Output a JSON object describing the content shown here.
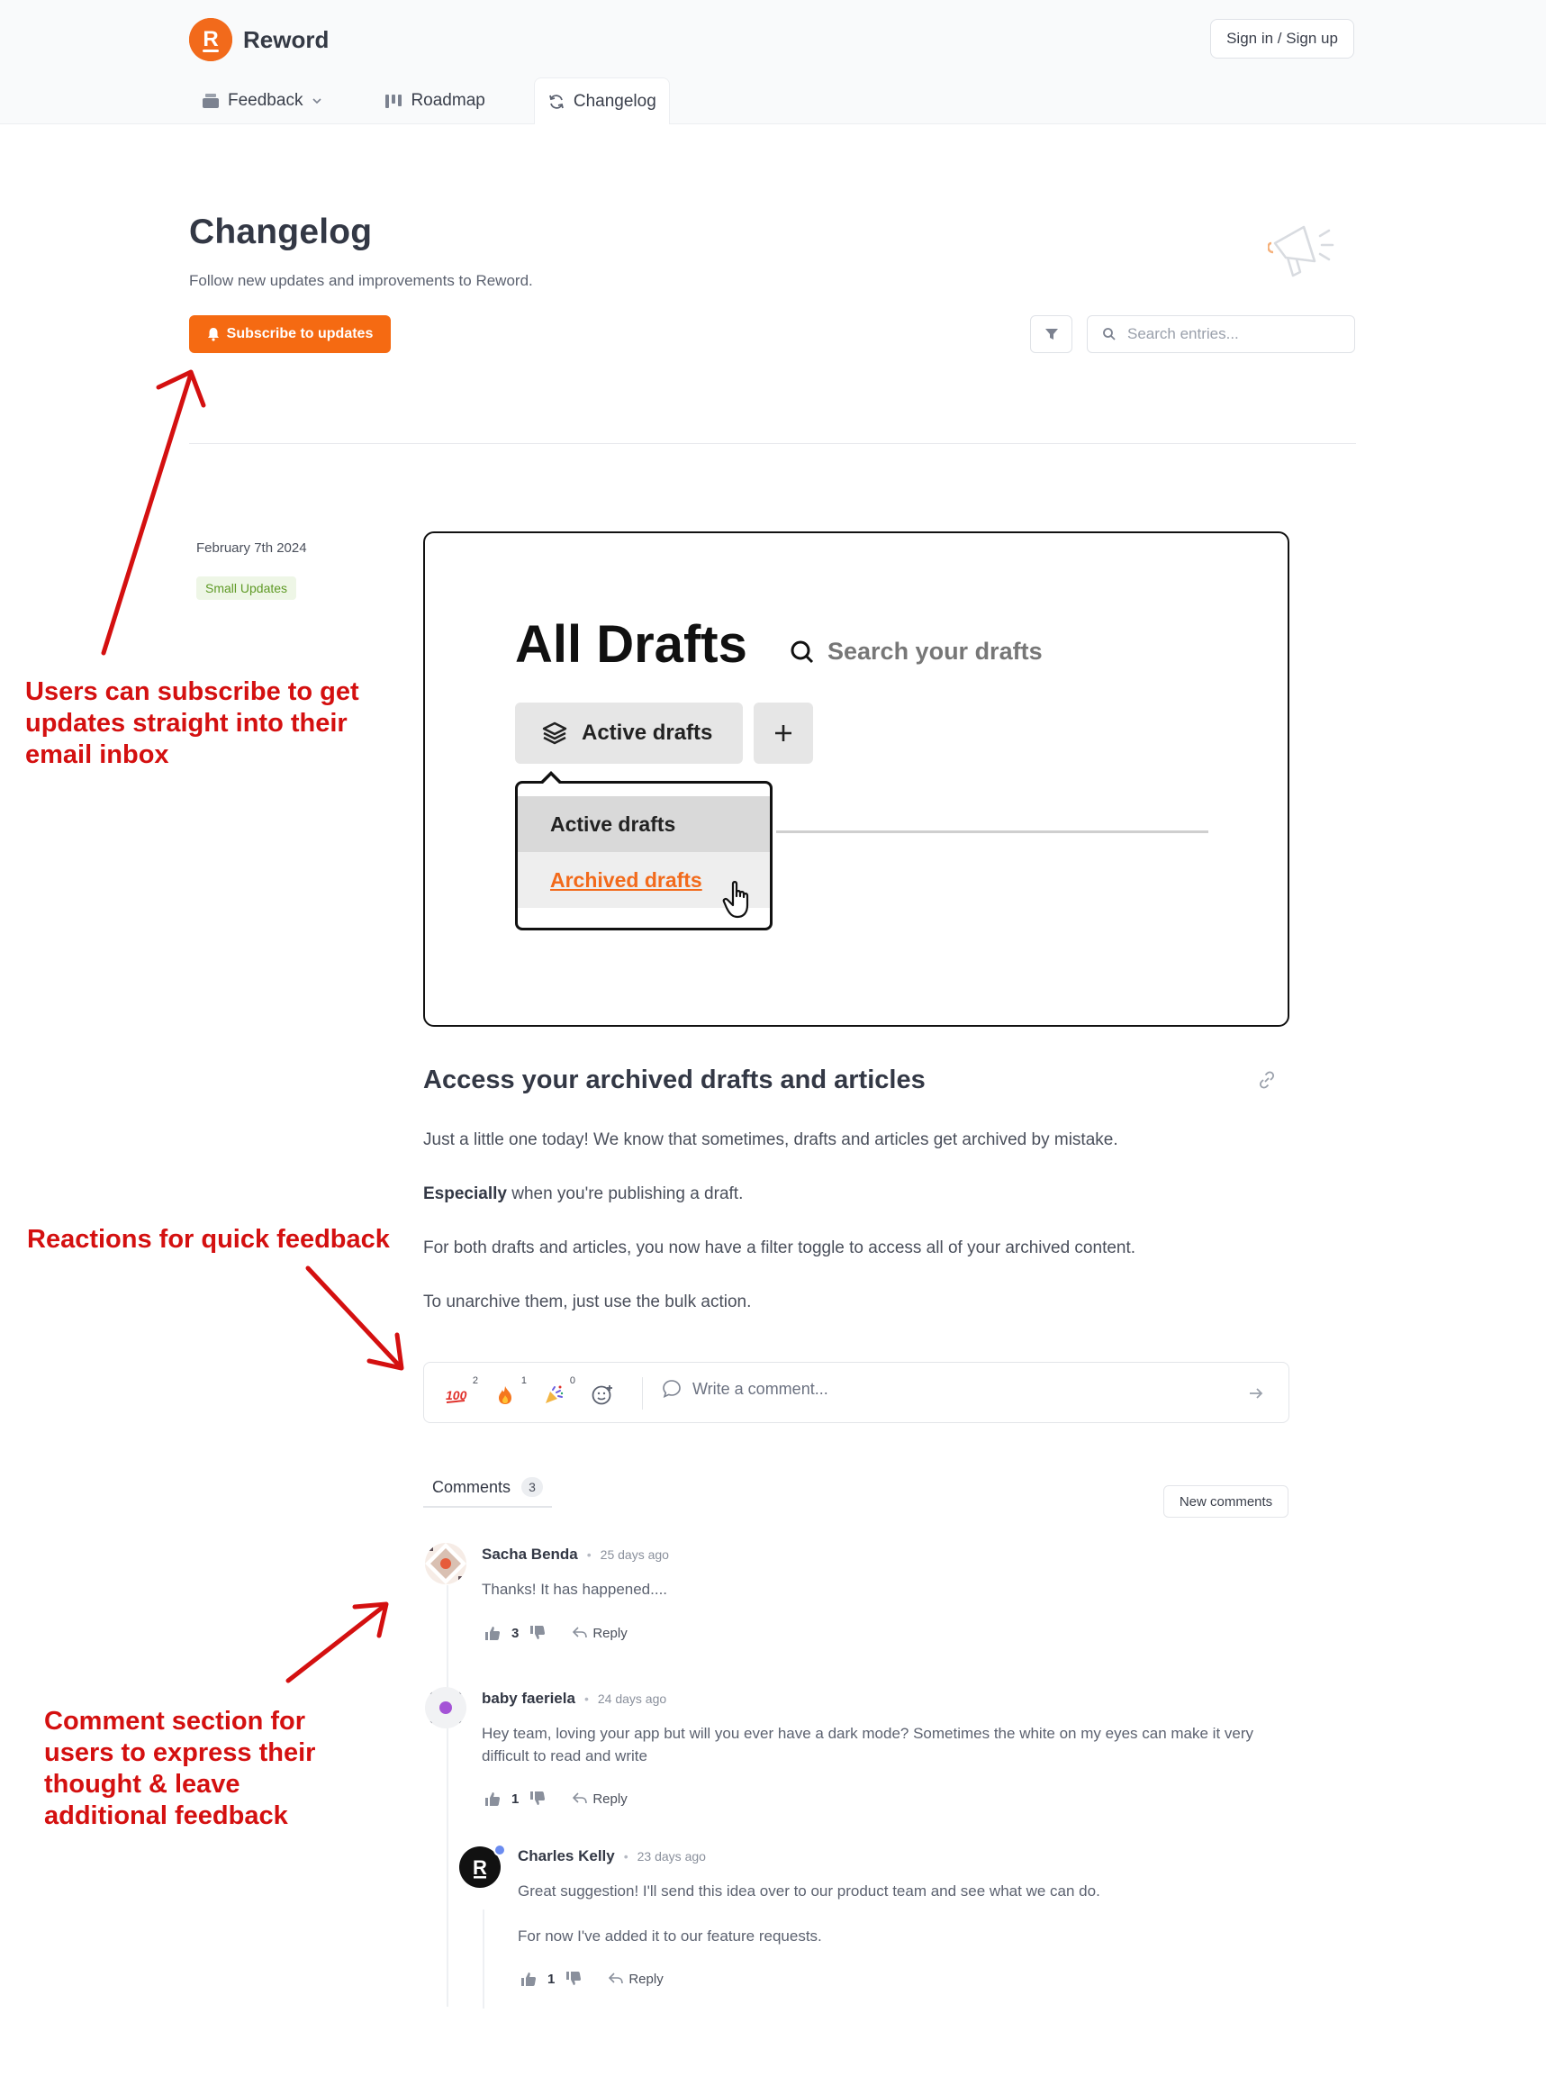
{
  "header": {
    "brand_name": "Reword",
    "brand_letter": "R",
    "signin_label": "Sign in / Sign up",
    "nav": [
      {
        "label": "Feedback",
        "icon": "inbox-icon"
      },
      {
        "label": "Roadmap",
        "icon": "roadmap-icon"
      },
      {
        "label": "Changelog",
        "icon": "refresh-icon",
        "active": true
      }
    ]
  },
  "page": {
    "title": "Changelog",
    "subtitle": "Follow new updates and improvements to Reword.",
    "subscribe_label": "Subscribe to updates",
    "search_placeholder": "Search entries..."
  },
  "entry": {
    "date": "February 7th 2024",
    "tag": "Small Updates",
    "screenshot": {
      "title": "All Drafts",
      "search_text": "Search your drafts",
      "active_button": "Active drafts",
      "menu_item_1": "Active drafts",
      "menu_item_2": "Archived drafts"
    },
    "title": "Access your archived drafts and articles",
    "paragraph_1": "Just a little one today! We know that sometimes, drafts and articles get archived by mistake.",
    "paragraph_2_bold": "Especially",
    "paragraph_2_rest": " when you're publishing a draft.",
    "paragraph_3": "For both drafts and articles, you now have a filter toggle to access all of your archived content.",
    "paragraph_4": "To unarchive them, just use the bulk action."
  },
  "reactions": [
    {
      "icon": "hundred-points-icon",
      "count": "2"
    },
    {
      "icon": "fire-icon",
      "count": "1"
    },
    {
      "icon": "party-popper-icon",
      "count": "0"
    }
  ],
  "comment_placeholder": "Write a comment...",
  "comments_section": {
    "tab_label": "Comments",
    "count": "3",
    "new_comments_label": "New comments",
    "reply_label": "Reply",
    "comments": [
      {
        "author": "Sacha Benda",
        "time": "25 days ago",
        "body": "Thanks! It has happened....",
        "likes": "3"
      },
      {
        "author": "baby faeriela",
        "time": "24 days ago",
        "body": "Hey team, loving your app but will you ever have a dark mode? Sometimes the white on my eyes can make it very difficult to read and write",
        "likes": "1"
      },
      {
        "author": "Charles Kelly",
        "time": "23 days ago",
        "body_1": "Great suggestion! I'll send this idea over to our product team and see what we can do.",
        "body_2": "For now I've added it to our feature requests.",
        "likes": "1"
      }
    ]
  },
  "annotations": {
    "subscribe_note": "Users can subscribe to get updates straight into their email inbox",
    "reactions_note": "Reactions for quick feedback",
    "comments_note": "Comment section for users to express their thought & leave additional feedback"
  },
  "colors": {
    "accent": "#f56a12",
    "annotation": "#d41010",
    "tag_green": "#5f9a26"
  }
}
